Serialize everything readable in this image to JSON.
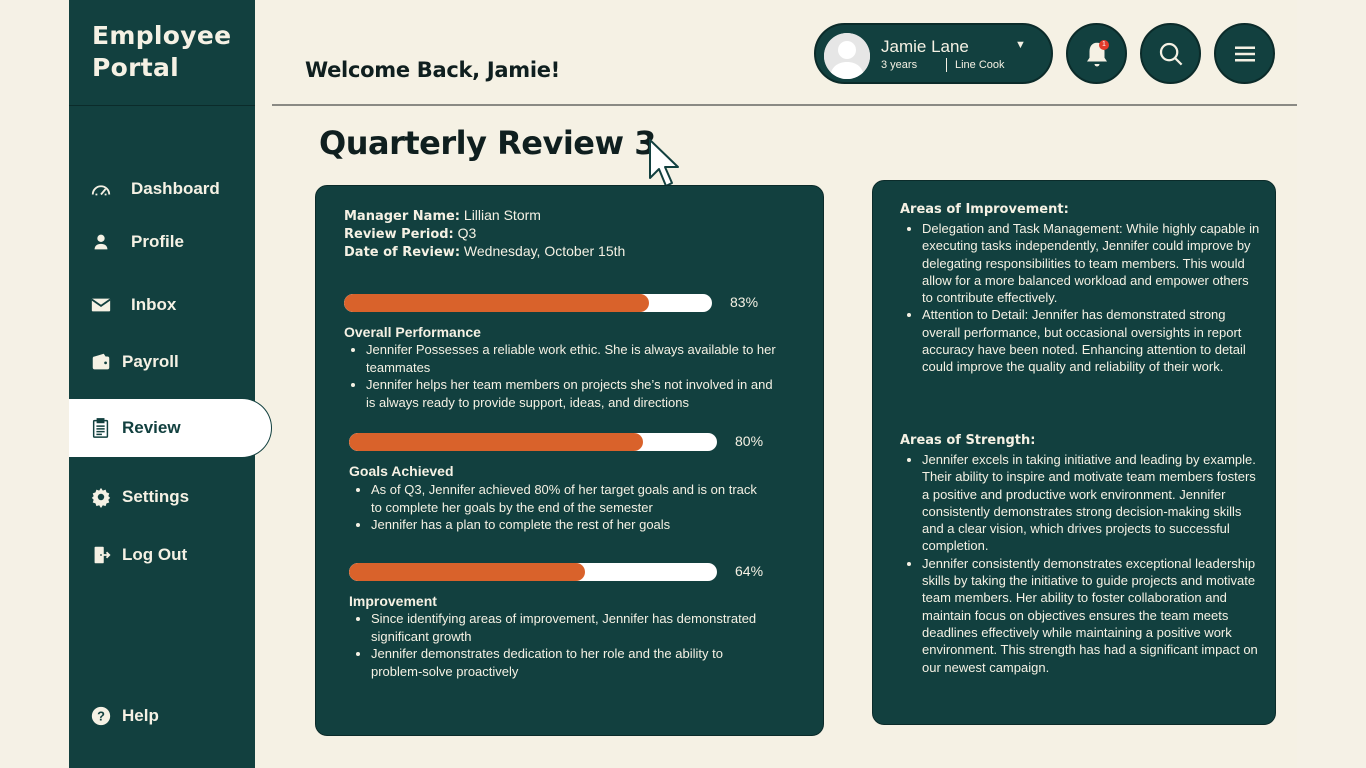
{
  "app": {
    "title_line1": "Employee",
    "title_line2": "Portal"
  },
  "sidebar": {
    "items": [
      {
        "label": "Dashboard",
        "icon": "gauge-icon"
      },
      {
        "label": "Profile",
        "icon": "person-icon"
      },
      {
        "label": "Inbox",
        "icon": "mail-icon"
      },
      {
        "label": "Payroll",
        "icon": "wallet-icon"
      },
      {
        "label": "Review",
        "icon": "clipboard-icon",
        "active": true
      },
      {
        "label": "Settings",
        "icon": "gear-icon"
      },
      {
        "label": "Log Out",
        "icon": "logout-icon"
      }
    ],
    "help_label": "Help"
  },
  "header": {
    "welcome": "Welcome Back, Jamie!",
    "user": {
      "name": "Jamie Lane",
      "tenure": "3 years",
      "role": "Line Cook"
    },
    "notification_count": "1"
  },
  "page_title": "Quarterly Review 3",
  "review": {
    "manager_label": "Manager Name:",
    "manager_value": "Lillian Storm",
    "period_label": "Review Period:",
    "period_value": "Q3",
    "date_label": "Date of Review:",
    "date_value": "Wednesday, October 15th",
    "metrics": [
      {
        "title": "Overall Performance",
        "percent": 83,
        "percent_label": "83%",
        "bullets": [
          "Jennifer Possesses a reliable work ethic. She is always available to her teammates",
          "Jennifer helps her team members on projects she’s not involved in and is always ready to provide support, ideas, and directions"
        ]
      },
      {
        "title": "Goals Achieved",
        "percent": 80,
        "percent_label": "80%",
        "bullets": [
          "As of Q3, Jennifer achieved 80% of her target goals and is on track to complete her goals by the end of the semester",
          "Jennifer has a plan to complete the rest of her goals"
        ]
      },
      {
        "title": "Improvement",
        "percent": 64,
        "percent_label": "64%",
        "bullets": [
          "Since identifying areas of improvement, Jennifer has demonstrated significant growth",
          "Jennifer demonstrates dedication to her role and the ability to problem-solve proactively"
        ]
      }
    ]
  },
  "feedback": {
    "improvement_title": "Areas of Improvement:",
    "improvement_items": [
      "Delegation and Task Management: While highly capable in executing tasks independently, Jennifer could improve by delegating responsibilities to team members. This would allow for a more balanced workload and empower others to contribute effectively.",
      "Attention to Detail: Jennifer has demonstrated strong overall performance, but occasional oversights in report accuracy have been noted. Enhancing attention to detail could improve the quality and reliability of their work."
    ],
    "strength_title": "Areas of Strength:",
    "strength_items": [
      "Jennifer excels in taking initiative and leading by example. Their ability to inspire and motivate team members fosters a positive and productive work environment. Jennifer consistently demonstrates strong decision-making skills and a clear vision, which drives projects to successful completion.",
      "Jennifer consistently demonstrates exceptional leadership skills by taking the initiative to guide projects and motivate team members. Her ability to foster collaboration and maintain focus on objectives ensures the team meets deadlines effectively while maintaining a positive work environment. This strength has had a significant impact on our newest campaign."
    ]
  },
  "colors": {
    "primary": "#12403f",
    "background": "#f5f1e4",
    "accent": "#d9622b",
    "notification": "#e23a2a"
  }
}
